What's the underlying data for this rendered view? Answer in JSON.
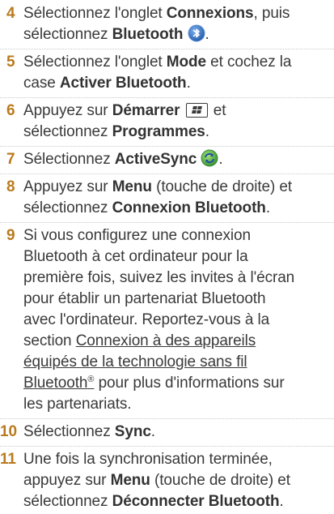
{
  "steps": [
    {
      "number": "4",
      "parts": [
        "Sélectionnez l'onglet ",
        "Connexions",
        ", puis",
        "sélectionnez ",
        "Bluetooth",
        "."
      ],
      "icon": "bluetooth-icon"
    },
    {
      "number": "5",
      "parts": [
        "Sélectionnez l'onglet ",
        "Mode",
        " et cochez la",
        "case ",
        "Activer Bluetooth",
        "."
      ]
    },
    {
      "number": "6",
      "parts": [
        "Appuyez sur ",
        "Démarrer",
        " et",
        "sélectionnez ",
        "Programmes",
        "."
      ],
      "icon": "windows-start-key-icon"
    },
    {
      "number": "7",
      "parts": [
        "Sélectionnez ",
        "ActiveSync",
        "."
      ],
      "icon": "activesync-icon"
    },
    {
      "number": "8",
      "parts": [
        "Appuyez sur ",
        "Menu",
        " (touche de droite) et",
        "sélectionnez ",
        "Connexion Bluetooth",
        "."
      ]
    },
    {
      "number": "9",
      "lines": [
        "Si vous configurez une connexion",
        "Bluetooth à cet ordinateur pour la",
        "première fois, suivez les invites à l'écran",
        "pour établir un partenariat Bluetooth",
        "avec l'ordinateur. Reportez-vous à la",
        "section "
      ],
      "link_lines": [
        "Connexion à des appareils",
        "équipés de la technologie sans fil",
        "Bluetooth",
        "®"
      ],
      "after_link": [
        " pour plus d'informations sur",
        "les partenariats."
      ]
    },
    {
      "number": "10",
      "parts": [
        "Sélectionnez ",
        "Sync",
        "."
      ]
    },
    {
      "number": "11",
      "parts": [
        "Une fois la synchronisation terminée,",
        "appuyez sur ",
        "Menu",
        " (touche de droite) et",
        "sélectionnez ",
        "Déconnecter Bluetooth",
        "."
      ]
    }
  ],
  "colors": {
    "step_number": "#ba7a1d",
    "body_text": "#3a3a3a",
    "separator": "#c9c9c9",
    "bluetooth_blue": "#2f6fc6",
    "activesync_green": "#3aa13a"
  }
}
